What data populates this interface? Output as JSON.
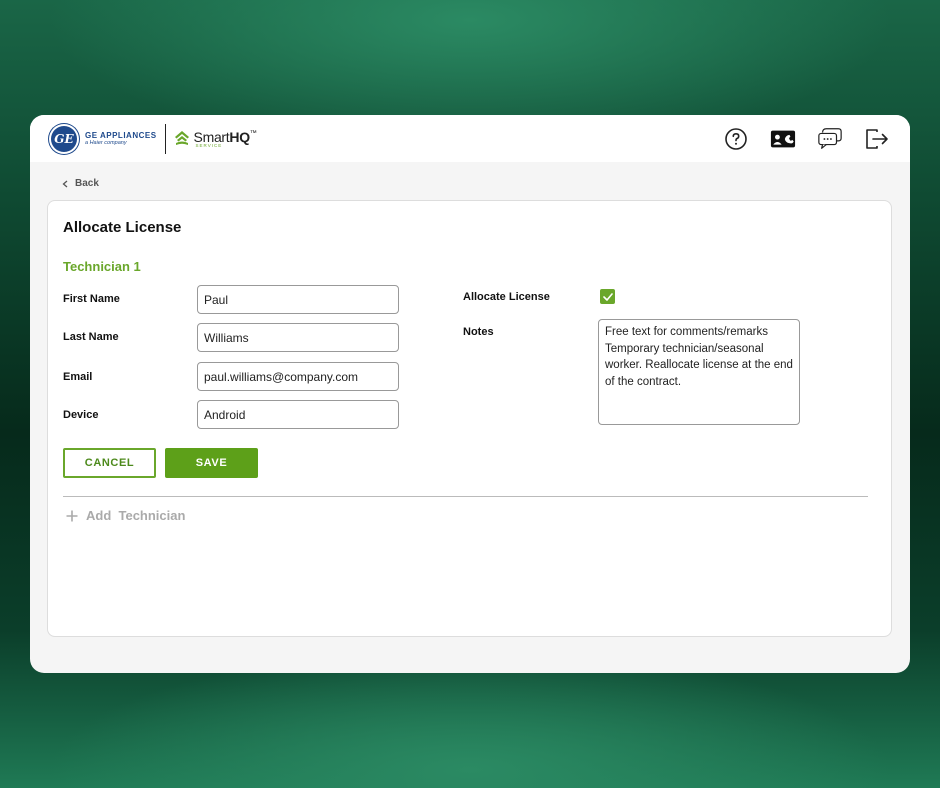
{
  "header": {
    "ge_logo_text": "GE",
    "brand_name": "GE APPLIANCES",
    "brand_tagline": "a Haier company",
    "product_name_regular": "Smart",
    "product_name_bold": "HQ",
    "product_trademark": "™",
    "product_sub": "SERVICE",
    "icons": [
      "help-icon",
      "contact-card-icon",
      "support-chat-icon",
      "logout-icon"
    ]
  },
  "nav": {
    "back_label": "Back"
  },
  "form": {
    "title": "Allocate License",
    "technician_heading": "Technician 1",
    "fields": {
      "first_name": {
        "label": "First Name",
        "value": "Paul"
      },
      "last_name": {
        "label": "Last Name",
        "value": "Williams"
      },
      "email": {
        "label": "Email",
        "value": "paul.williams@company.com"
      },
      "device": {
        "label": "Device",
        "value": "Android"
      }
    },
    "allocate_license": {
      "label": "Allocate License",
      "checked": true
    },
    "notes": {
      "label": "Notes",
      "value": "Free text for comments/remarks Temporary technician/seasonal worker. Reallocate license at the end of the contract."
    },
    "cancel_label": "CANCEL",
    "save_label": "SAVE",
    "add_technician_label": "Add  Technician"
  },
  "colors": {
    "accent_green": "#6aa72b",
    "save_green": "#5da019",
    "ge_blue": "#1f4a8c"
  }
}
